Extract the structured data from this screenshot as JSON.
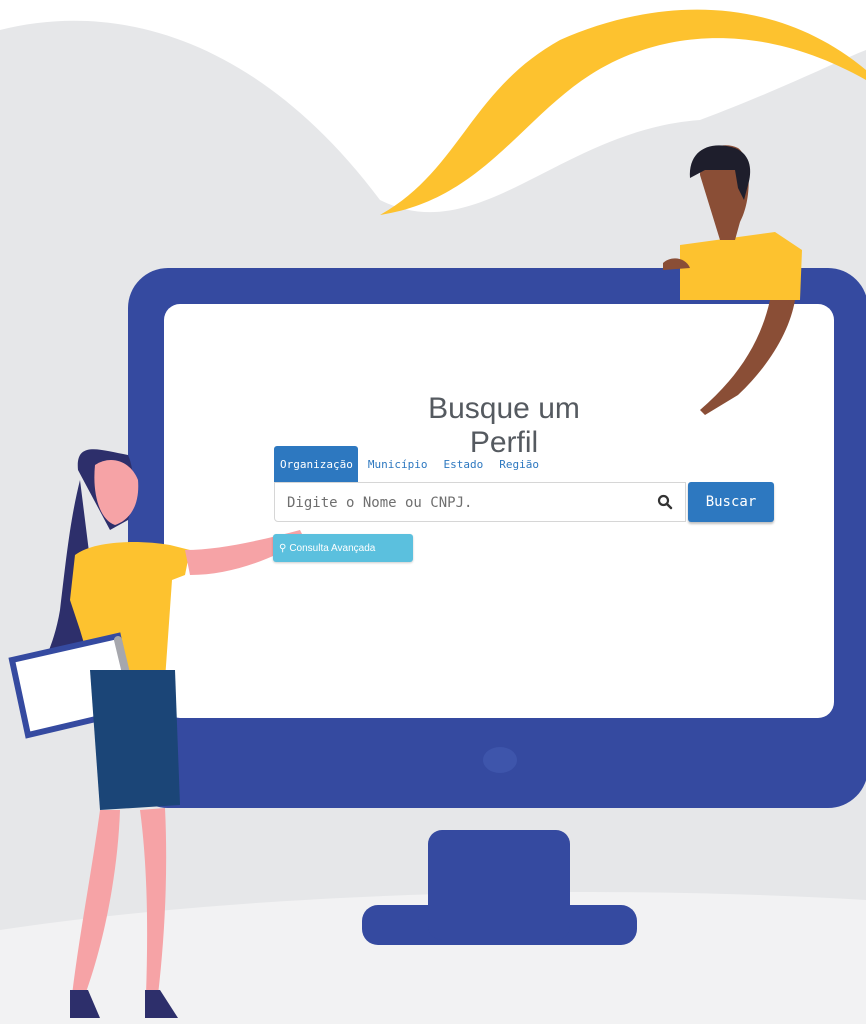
{
  "search_widget": {
    "title": "Busque um Perfil",
    "tabs": [
      {
        "label": "Organização",
        "active": true
      },
      {
        "label": "Município",
        "active": false
      },
      {
        "label": "Estado",
        "active": false
      },
      {
        "label": "Região",
        "active": false
      }
    ],
    "search_placeholder": "Digite o Nome ou CNPJ.",
    "search_button_label": "Buscar",
    "advanced_button_label": "Consulta Avançada"
  },
  "colors": {
    "monitor_frame": "#354aa0",
    "primary_button": "#2d78c0",
    "advanced_button": "#5bc0de",
    "accent_yellow": "#fdc22f",
    "background_gray": "#e6e7e9"
  }
}
